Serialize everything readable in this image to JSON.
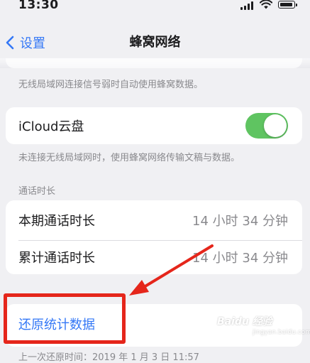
{
  "status_bar": {
    "time": "13:30"
  },
  "nav": {
    "back_label": "设置",
    "title": "蜂窝网络"
  },
  "wifi_assist": {
    "footnote": "无线局域网连接信号弱时自动使用蜂窝数据。"
  },
  "icloud": {
    "label": "iCloud云盘",
    "enabled": true,
    "footnote": "未连接无线局域网时，使用蜂窝网络传输文稿与数据。"
  },
  "call_time": {
    "header": "通话时长",
    "rows": [
      {
        "label": "本期通话时长",
        "value": "14 小时 34 分钟"
      },
      {
        "label": "累计通话时长",
        "value": "14 小时 34 分钟"
      }
    ]
  },
  "reset": {
    "label": "还原统计数据",
    "footnote": "上一次还原时间：2019 年 1 月 3 日 11:57"
  },
  "annotation": {
    "color": "#e5261b"
  },
  "watermark": {
    "text": "Baidu 经验",
    "sub": "jingyan.baidu.com"
  },
  "colors": {
    "accent": "#3478f6",
    "toggle_on": "#5fc461",
    "background": "#f0f0f3"
  }
}
